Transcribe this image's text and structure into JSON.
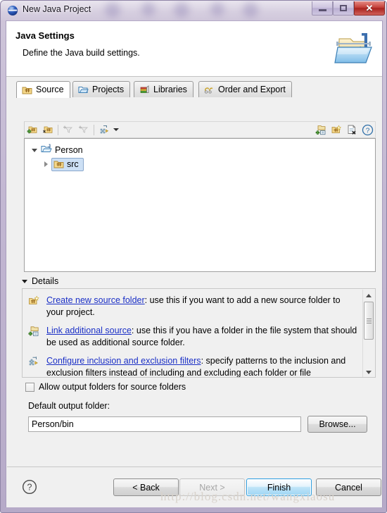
{
  "window": {
    "title": "New Java Project",
    "app_icon": "eclipse-sphere-icon",
    "minimize_label": "Minimize",
    "maximize_label": "Maximize",
    "close_label": "Close",
    "close_glyph": "✕"
  },
  "banner": {
    "title": "Java Settings",
    "subtitle": "Define the Java build settings.",
    "icon": "java-folder-banner-icon"
  },
  "tabs": [
    {
      "label": "Source",
      "icon": "source-folder-icon",
      "selected": true
    },
    {
      "label": "Projects",
      "icon": "projects-folder-icon",
      "selected": false
    },
    {
      "label": "Libraries",
      "icon": "libraries-books-icon",
      "selected": false
    },
    {
      "label": "Order and Export",
      "icon": "order-export-icon",
      "selected": false
    }
  ],
  "toolbar": {
    "left_buttons": [
      {
        "name": "add-folder-button",
        "enabled": true
      },
      {
        "name": "link-source-button",
        "enabled": true
      },
      {
        "name": "add-inclusion-filter-button",
        "enabled": false
      },
      {
        "name": "add-exclusion-filter-button",
        "enabled": false
      },
      {
        "name": "configure-filters-button",
        "enabled": true
      }
    ],
    "dropdown_label": "▼",
    "right_buttons": [
      {
        "name": "link-additional-source-button"
      },
      {
        "name": "create-new-source-folder-button"
      },
      {
        "name": "remove-from-buildpath-button"
      },
      {
        "name": "help-button"
      }
    ]
  },
  "tree": {
    "nodes": [
      {
        "label": "Person",
        "icon": "java-project-icon",
        "expanded": true,
        "selected": false
      },
      {
        "label": "src",
        "icon": "source-folder-icon",
        "expanded": false,
        "selected": true
      }
    ]
  },
  "details": {
    "header": "Details",
    "items": [
      {
        "icon": "create-new-source-folder-icon",
        "link": "Create new source folder",
        "text": ": use this if you want to add a new source folder to your project."
      },
      {
        "icon": "link-additional-source-icon",
        "link": "Link additional source",
        "text": ": use this if you have a folder in the file system that should be used as additional source folder."
      },
      {
        "icon": "configure-filters-icon",
        "link": "Configure inclusion and exclusion filters",
        "text": ": specify patterns to the inclusion and exclusion filters instead of including and excluding each folder or file"
      }
    ],
    "scrollbar": {
      "up": "▲",
      "down": "▼"
    }
  },
  "allow_output": {
    "label": "Allow output folders for source folders",
    "checked": false
  },
  "output_folder": {
    "label": "Default output folder:",
    "value": "Person/bin",
    "placeholder": "",
    "browse_label": "Browse..."
  },
  "buttons": {
    "help": "?",
    "back": "< Back",
    "next": "Next >",
    "finish": "Finish",
    "cancel": "Cancel"
  },
  "watermark": "http://blog.csdn.net/wangxiaosu",
  "colors": {
    "frame": "#b6aac8",
    "close_red": "#c4403a",
    "link_blue": "#1a2fc6",
    "selection_blue": "#cde0f5",
    "finish_blue": "#9ed6f4",
    "dialog_gray": "#f0f0f0"
  }
}
